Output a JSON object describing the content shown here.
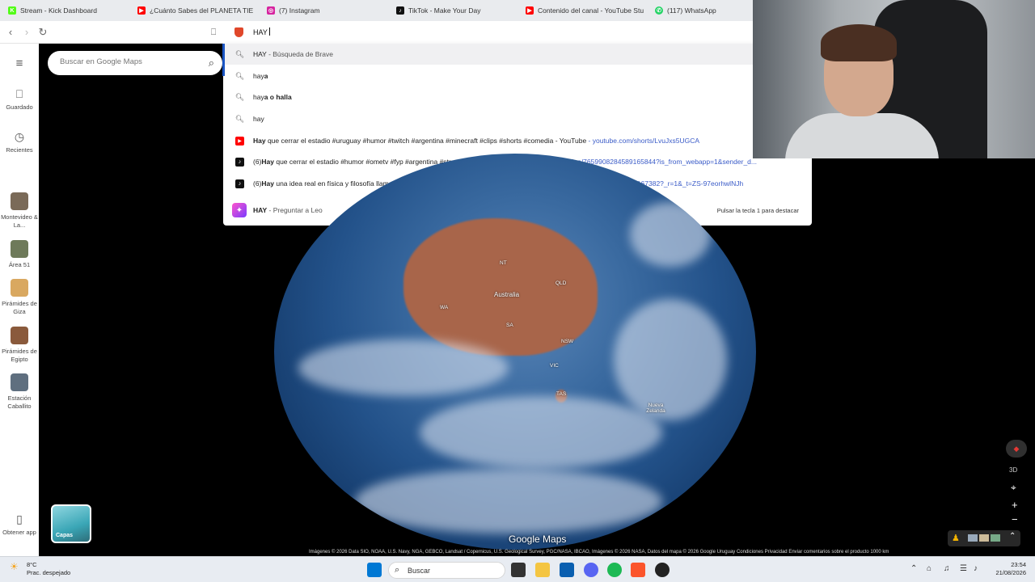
{
  "tabs": [
    {
      "title": "Stream - Kick Dashboard",
      "icon": "kick-icon",
      "color": "#53fc18"
    },
    {
      "title": "¿Cuánto Sabes del PLANETA TIE",
      "icon": "youtube-icon",
      "color": "#ff0000"
    },
    {
      "title": "(7) Instagram",
      "icon": "instagram-icon",
      "color": "#d6249f"
    },
    {
      "title": "TikTok - Make Your Day",
      "icon": "tiktok-icon",
      "color": "#111111"
    },
    {
      "title": "Contenido del canal - YouTube Stu",
      "icon": "youtube-icon",
      "color": "#ff0000"
    },
    {
      "title": "(117) WhatsApp",
      "icon": "whatsapp-icon",
      "color": "#25d366"
    }
  ],
  "omnibox": {
    "value": "HAY"
  },
  "suggestions": [
    {
      "kind": "search",
      "bold": "HAY",
      "rest": "",
      "desc": " - Búsqueda de Brave",
      "url": ""
    },
    {
      "kind": "search",
      "bold": "",
      "pre": "hay",
      "rest": "a",
      "desc": "",
      "url": ""
    },
    {
      "kind": "search",
      "pre": "hay",
      "rest": "a o halla",
      "desc": "",
      "url": ""
    },
    {
      "kind": "search",
      "pre": "hay",
      "rest": "",
      "desc": "",
      "url": ""
    },
    {
      "kind": "youtube",
      "bold": "Hay",
      "rest": " que cerrar el estadio #uruguay #humor #twitch #argentina #minecraft #clips #shorts #comedia - YouTube",
      "url": " - youtube.com/shorts/LvuJxs5UGCA"
    },
    {
      "kind": "tiktok",
      "pre": "(6)",
      "bold": "Hay",
      "rest": " que cerrar el estadio #humor #ometv #fyp #argentina #stream | TikTok",
      "url": " - tiktok.com/@inachito7/video/7659908284589165844?is_from_webapp=1&sender_d..."
    },
    {
      "kind": "tiktok",
      "pre": "(6)",
      "bold": "Hay",
      "rest": " una idea real en física y filosofía llamada la hipótesis de la sim... | TikTok",
      "url": " - tiktok.com/@bycraah/video/7646447626837167382?_r=1&_t=ZS-97eorhwlNJh"
    }
  ],
  "leo": {
    "bold": "HAY",
    "desc": " - Preguntar a Leo",
    "hint": "Pulsar la tecla 1 para destacar"
  },
  "rail": {
    "saved": "Guardado",
    "recent": "Recientes",
    "places": [
      {
        "label": "Montevideo & La...",
        "color": "#7a6a58"
      },
      {
        "label": "Área 51",
        "color": "#6e7a5a"
      },
      {
        "label": "Pirámides de Giza",
        "color": "#d9a860"
      },
      {
        "label": "Pirámides de Egipto",
        "color": "#8a5a3c"
      },
      {
        "label": "Estación Caballito",
        "color": "#5f6f7f"
      }
    ],
    "get_app": "Obtener app"
  },
  "maps_search": {
    "placeholder": "Buscar en Google Maps"
  },
  "map_labels": {
    "australia": "Australia",
    "nt": "NT",
    "qld": "QLD",
    "wa": "WA",
    "sa": "SA",
    "nsw": "NSW",
    "vic": "VIC",
    "tas": "TAS",
    "nz": "Nueva Zelanda"
  },
  "layers_label": "Capas",
  "logo": "Google Maps",
  "credits": "Imágenes © 2026 Data SIO, NOAA, U.S. Navy, NGA, GEBCO, Landsat / Copernicus, U.S. Geological Survey, PGC/NASA, IBCAO, Imágenes © 2026 NASA, Datos del mapa © 2026 Google     Uruguay     Condiciones     Privacidad     Enviar comentarios sobre el producto     1000 km",
  "view_3d": "3D",
  "taskbar": {
    "temp": "8°C",
    "weather": "Prac. despejado",
    "search": "Buscar",
    "time": "23:54",
    "date": "21/08/2026"
  }
}
